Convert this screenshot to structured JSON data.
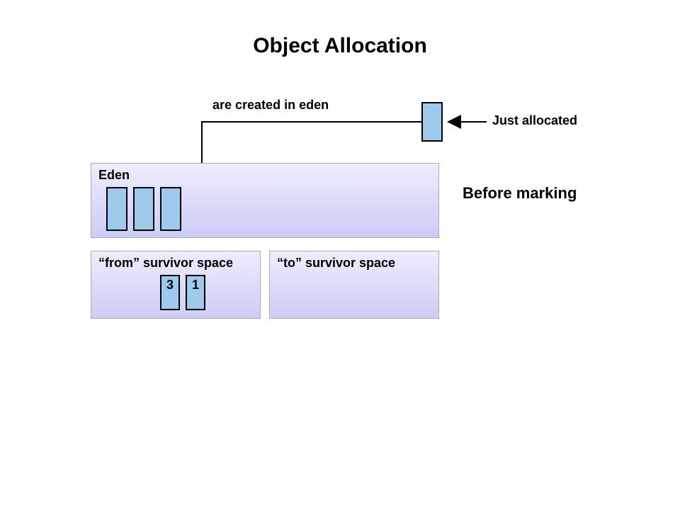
{
  "title": "Object Allocation",
  "labels": {
    "created_in_eden": "are created in eden",
    "just_allocated": "Just allocated",
    "before_marking": "Before marking"
  },
  "regions": {
    "eden": {
      "title": "Eden"
    },
    "from_survivor": {
      "title": "“from” survivor space"
    },
    "to_survivor": {
      "title": "“to” survivor space"
    }
  },
  "objects": {
    "allocated_box": {},
    "eden_objs": [
      {},
      {},
      {}
    ],
    "from_survivor_objs": [
      {
        "age": "3"
      },
      {
        "age": "1"
      }
    ]
  },
  "colors": {
    "object_fill": "#9fc9ed",
    "region_top": "#f0ecff",
    "region_bottom": "#ccccf5"
  }
}
